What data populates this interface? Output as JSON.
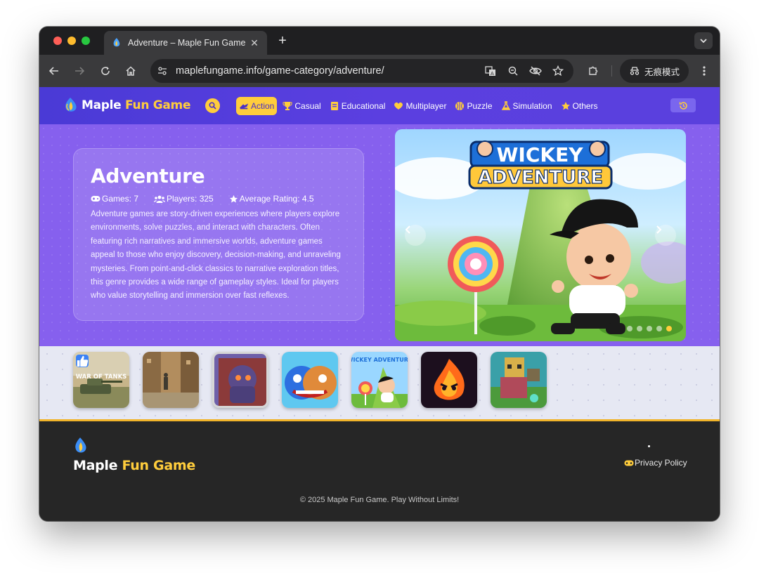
{
  "browser": {
    "tab_title": "Adventure – Maple Fun Game",
    "url": "maplefungame.info/game-category/adventure/",
    "incognito_label": "无痕模式"
  },
  "site": {
    "brand_main": "Maple ",
    "brand_accent": "Fun Game",
    "nav": [
      {
        "label": "Action",
        "icon": "action-icon",
        "active": true
      },
      {
        "label": "Casual",
        "icon": "trophy-icon",
        "active": false
      },
      {
        "label": "Educational",
        "icon": "book-icon",
        "active": false
      },
      {
        "label": "Multiplayer",
        "icon": "heart-icon",
        "active": false
      },
      {
        "label": "Puzzle",
        "icon": "puzzle-icon",
        "active": false
      },
      {
        "label": "Simulation",
        "icon": "flask-icon",
        "active": false
      },
      {
        "label": "Others",
        "icon": "star-icon",
        "active": false
      }
    ],
    "accent_color": "#ffcd3c",
    "header_color": "#4a3ad6"
  },
  "category": {
    "title": "Adventure",
    "games_label": "Games: 7",
    "players_label": "Players: 325",
    "rating_label": "Average Rating: 4.5",
    "description": "Adventure games are story-driven experiences where players explore environments, solve puzzles, and interact with characters. Often featuring rich narratives and immersive worlds, adventure games appeal to those who enjoy discovery, decision-making, and unraveling mysteries. From point-and-click classics to narrative exploration titles, this genre provides a wide range of gameplay styles. Ideal for players who value storytelling and immersion over fast reflexes."
  },
  "slider": {
    "title_line1": "WICKEY",
    "title_line2": "ADVENTURE",
    "slide_count": 5,
    "active_index": 4
  },
  "thumbnails": [
    {
      "name": "war-of-tanks",
      "caption": "WAR OF TANKS",
      "liked": true
    },
    {
      "name": "city-shooter",
      "caption": "",
      "liked": false
    },
    {
      "name": "robot-mech",
      "caption": "",
      "liked": false
    },
    {
      "name": "huggy-monster",
      "caption": "",
      "liked": false
    },
    {
      "name": "wickey-adventure",
      "caption": "WICKEY ADVENTURE",
      "liked": false
    },
    {
      "name": "angry-fire",
      "caption": "",
      "liked": false
    },
    {
      "name": "block-craft",
      "caption": "",
      "liked": false
    }
  ],
  "footer": {
    "brand_main": "Maple ",
    "brand_accent": "Fun Game",
    "privacy_label": "Privacy Policy",
    "copyright": "© 2025 Maple Fun Game. Play Without Limits!"
  }
}
